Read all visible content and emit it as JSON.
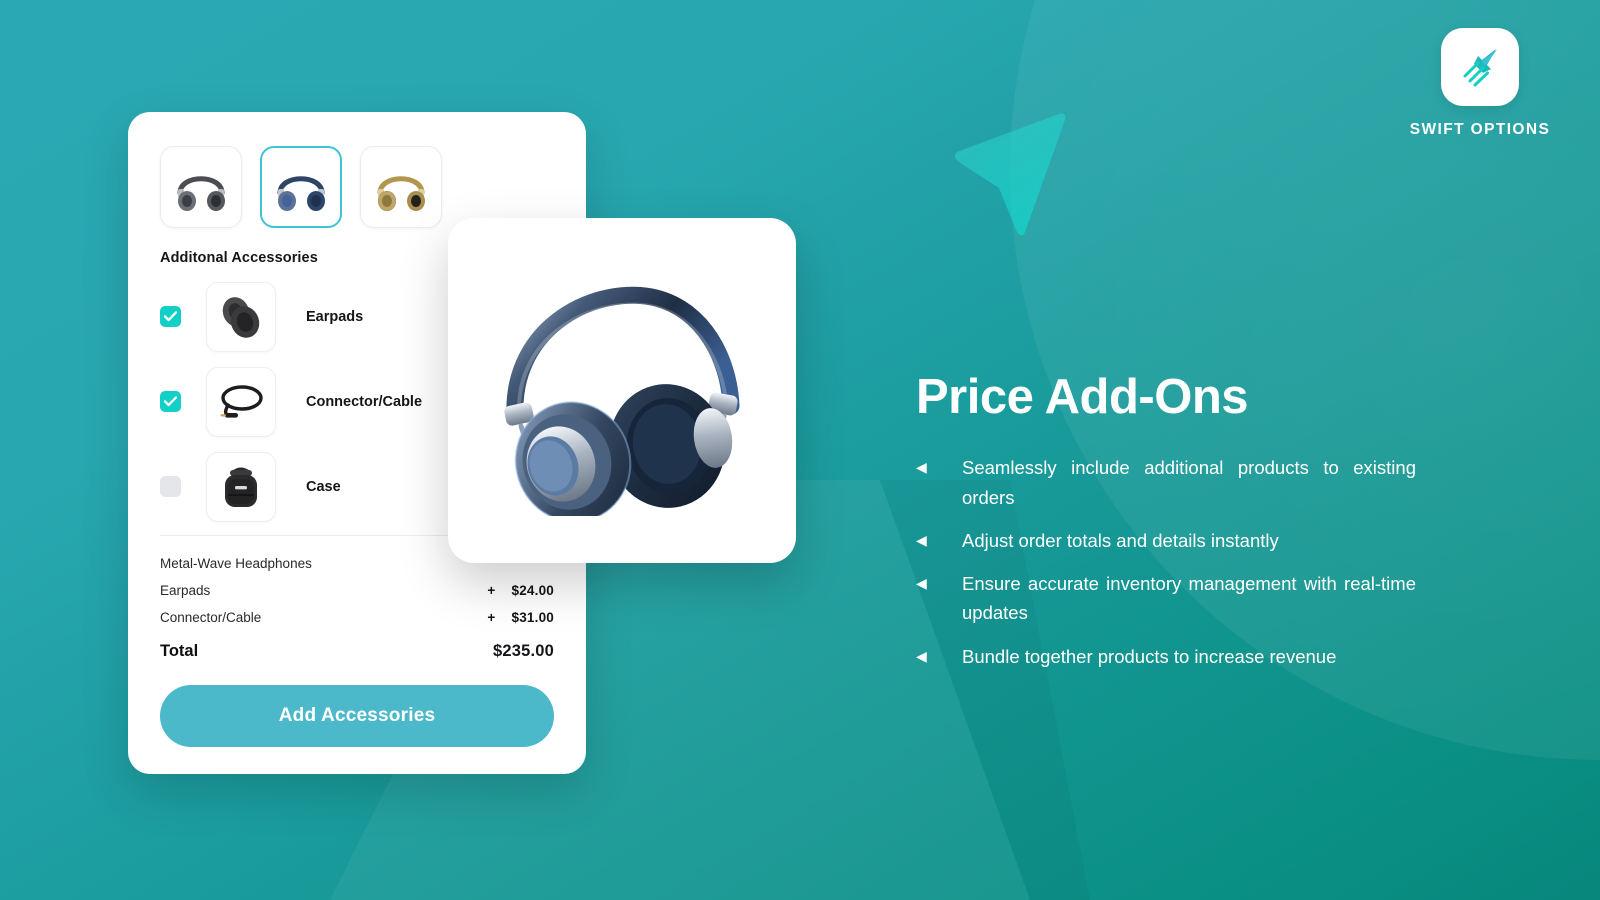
{
  "brand": {
    "name": "SWIFT OPTIONS",
    "logo_icon": "rocket-arrow-icon",
    "tile_color": "#ffffff",
    "mark_color": "#18c4bd"
  },
  "background": {
    "gradient_from": "#2aa8b4",
    "gradient_to": "#08877c",
    "accent_shape_icon": "cursor-arrow-shape",
    "accent_shape_color": "#2fd3cc"
  },
  "product_card": {
    "variants": [
      {
        "name": "Metal-Wave Headphones Graphite",
        "color": "#5a5d63",
        "selected": false
      },
      {
        "name": "Metal-Wave Headphones Navy",
        "color": "#3d5f8f",
        "selected": true
      },
      {
        "name": "Metal-Wave Headphones Gold",
        "color": "#b79b5a",
        "selected": false
      }
    ],
    "accessories_title": "Additonal Accessories",
    "accessories": [
      {
        "label": "Earpads",
        "checked": true,
        "icon": "earpads-thumbnail"
      },
      {
        "label": "Connector/Cable",
        "checked": true,
        "icon": "cable-thumbnail"
      },
      {
        "label": "Case",
        "checked": false,
        "icon": "case-thumbnail"
      }
    ],
    "summary": [
      {
        "label": "Metal-Wave Headphones",
        "amount": "",
        "plus": ""
      },
      {
        "label": "Earpads",
        "amount": "$24.00",
        "plus": "+"
      },
      {
        "label": "Connector/Cable",
        "amount": "$31.00",
        "plus": "+"
      }
    ],
    "total_label": "Total",
    "total_amount": "$235.00",
    "cta_label": "Add Accessories",
    "cta_color": "#4cb9cb",
    "checkbox_on_color": "#12cfc7",
    "checkbox_off_color": "#e4e6e9",
    "selected_border_color": "#3ec4d4"
  },
  "hero": {
    "image_icon": "navy-headphones-image",
    "alt": "Metal-Wave Headphones Navy"
  },
  "copy": {
    "headline": "Price Add-Ons",
    "bullet_marker": "◀",
    "bullets": [
      "Seamlessly include additional products to existing orders",
      "Adjust order totals and details instantly",
      "Ensure accurate inventory management with real-time updates",
      "Bundle together products to increase revenue"
    ]
  }
}
